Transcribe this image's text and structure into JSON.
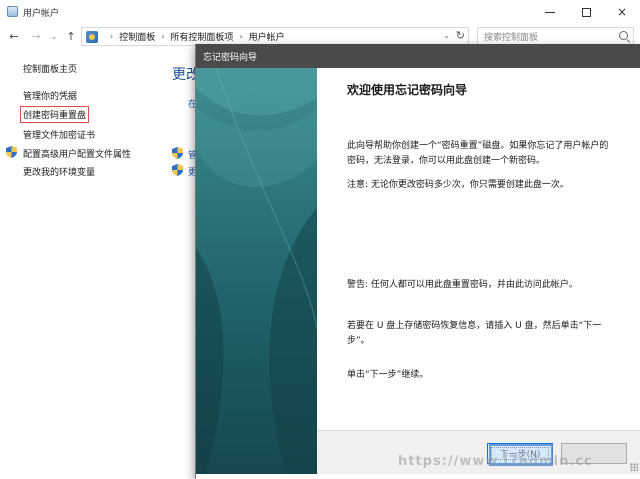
{
  "window": {
    "title": "用户帐户",
    "controls": {
      "minimize": "minimize-icon",
      "maximize": "maximize-icon",
      "close": "×"
    }
  },
  "nav": {
    "back": "←",
    "forward": "→",
    "up": "↑",
    "recent": "⌄",
    "breadcrumbs": [
      "控制面板",
      "所有控制面板项",
      "用户帐户"
    ],
    "sep": "›",
    "refresh": "↻",
    "dropdown": "⌄",
    "search_placeholder": "搜索控制面板"
  },
  "sidebar": {
    "items": [
      {
        "label": "控制面板主页",
        "shield": false
      },
      {
        "label": "管理你的凭据",
        "shield": false
      },
      {
        "label": "创建密码重置盘",
        "shield": false,
        "active": true
      },
      {
        "label": "管理文件加密证书",
        "shield": false
      },
      {
        "label": "配置高级用户配置文件属性",
        "shield": true
      },
      {
        "label": "更改我的环境变量",
        "shield": false
      }
    ]
  },
  "main": {
    "title_fragment": "更改",
    "link_fragment": "在",
    "item_fragments": [
      "管",
      "更"
    ]
  },
  "wizard": {
    "title": "忘记密码向导",
    "heading": "欢迎使用忘记密码向导",
    "paragraphs": [
      "此向导帮助你创建一个“密码重置”磁盘。如果你忘记了用户帐户的密码，无法登录，你可以用此盘创建一个新密码。",
      "注意: 无论你更改密码多少次，你只需要创建此盘一次。",
      "警告: 任何人都可以用此盘重置密码，并由此访问此帐户。",
      "若要在 U 盘上存储密码恢复信息，请插入 U 盘，然后单击“下一步”。",
      "单击“下一步”继续。"
    ],
    "next_button": "下一步(N)",
    "cancel_button": ""
  },
  "watermark": "https://www.i7admin.cc"
}
